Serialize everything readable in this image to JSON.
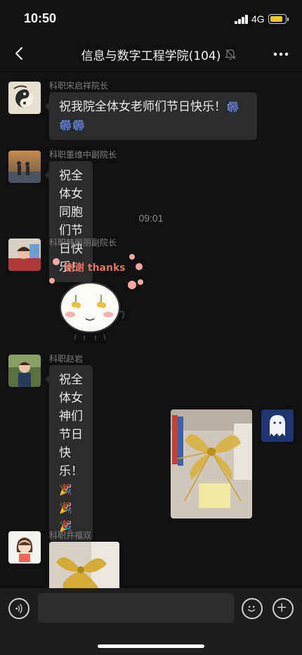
{
  "status_bar": {
    "time": "10:50",
    "network": "4G",
    "battery_color": "#f3c62e"
  },
  "nav": {
    "title": "信息与数字工程学院(104)",
    "back_icon": "chevron-left-icon",
    "mute_icon": "bell-muted-icon",
    "more_icon": "more-dots-icon"
  },
  "messages": [
    {
      "sender": "科职宋启祥院长",
      "text": "祝我院全体女老师们节日快乐！",
      "text_tail": "🎆🎆🎆",
      "avatar": "yin-yang-avatar"
    },
    {
      "sender": "科职董维中副院长",
      "text": "祝全体女同胞们节日快乐！",
      "avatar": "sunset-couple-avatar"
    },
    {
      "sender": "科职韩丽丽副院长",
      "sticker_text": "谢谢 thanks",
      "avatar": "child-avatar"
    },
    {
      "sender": "科职赵岩",
      "text": "祝全体女神们节日快乐！",
      "text_tail": "🎉🎉🎉",
      "avatar": "toddler-avatar"
    },
    {
      "outgoing": true,
      "image": "gift-bow-photo",
      "avatar": "ghost-avatar"
    },
    {
      "sender": "科职井福双",
      "image": "gift-bow-photo-partial",
      "avatar": "cartoon-girl-avatar"
    }
  ],
  "timestamp": "09:01",
  "input_bar": {
    "voice_icon": "voice-icon",
    "emoji_icon": "emoji-icon",
    "plus_icon": "plus-icon",
    "placeholder": ""
  },
  "colors": {
    "background": "#111111",
    "bubble": "#2c2c2c",
    "input_bar": "#1e1e1e"
  }
}
